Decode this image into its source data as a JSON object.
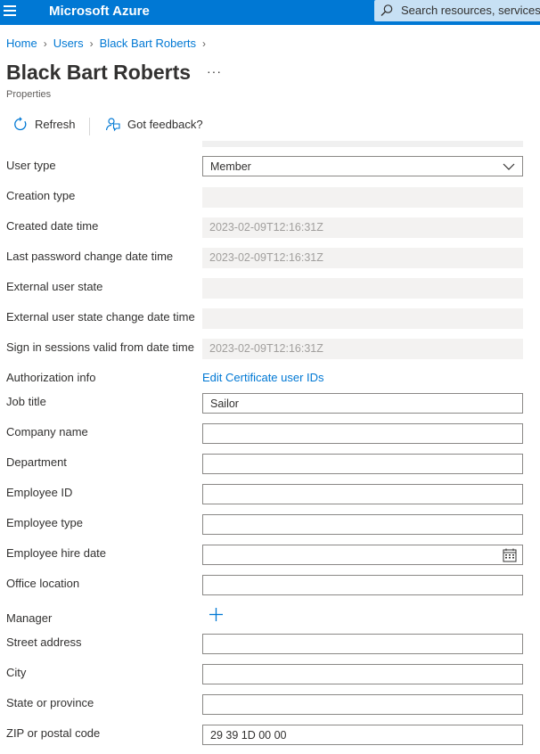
{
  "header": {
    "brand": "Microsoft Azure",
    "search_placeholder": "Search resources, services, a",
    "accent_color": "#0078d4"
  },
  "breadcrumb": {
    "items": [
      "Home",
      "Users",
      "Black Bart Roberts"
    ]
  },
  "page": {
    "title": "Black Bart Roberts",
    "more": "···",
    "subtitle": "Properties"
  },
  "toolbar": {
    "refresh_label": "Refresh",
    "feedback_label": "Got feedback?"
  },
  "form": {
    "user_type": {
      "label": "User type",
      "value": "Member"
    },
    "creation_type": {
      "label": "Creation type",
      "value": ""
    },
    "created_date_time": {
      "label": "Created date time",
      "value": "2023-02-09T12:16:31Z"
    },
    "last_password_change": {
      "label": "Last password change date time",
      "value": "2023-02-09T12:16:31Z"
    },
    "external_user_state": {
      "label": "External user state",
      "value": ""
    },
    "external_user_state_change": {
      "label": "External user state change date time",
      "value": ""
    },
    "sign_in_sessions_valid": {
      "label": "Sign in sessions valid from date time",
      "value": "2023-02-09T12:16:31Z"
    },
    "authorization_info": {
      "label": "Authorization info",
      "link": "Edit Certificate user IDs"
    },
    "job_title": {
      "label": "Job title",
      "value": "Sailor"
    },
    "company_name": {
      "label": "Company name",
      "value": ""
    },
    "department": {
      "label": "Department",
      "value": ""
    },
    "employee_id": {
      "label": "Employee ID",
      "value": ""
    },
    "employee_type": {
      "label": "Employee type",
      "value": ""
    },
    "employee_hire_date": {
      "label": "Employee hire date",
      "value": ""
    },
    "office_location": {
      "label": "Office location",
      "value": ""
    },
    "manager": {
      "label": "Manager"
    },
    "street_address": {
      "label": "Street address",
      "value": ""
    },
    "city": {
      "label": "City",
      "value": ""
    },
    "state_or_province": {
      "label": "State or province",
      "value": ""
    },
    "zip_or_postal_code": {
      "label": "ZIP or postal code",
      "value": "29 39 1D 00 00"
    }
  }
}
